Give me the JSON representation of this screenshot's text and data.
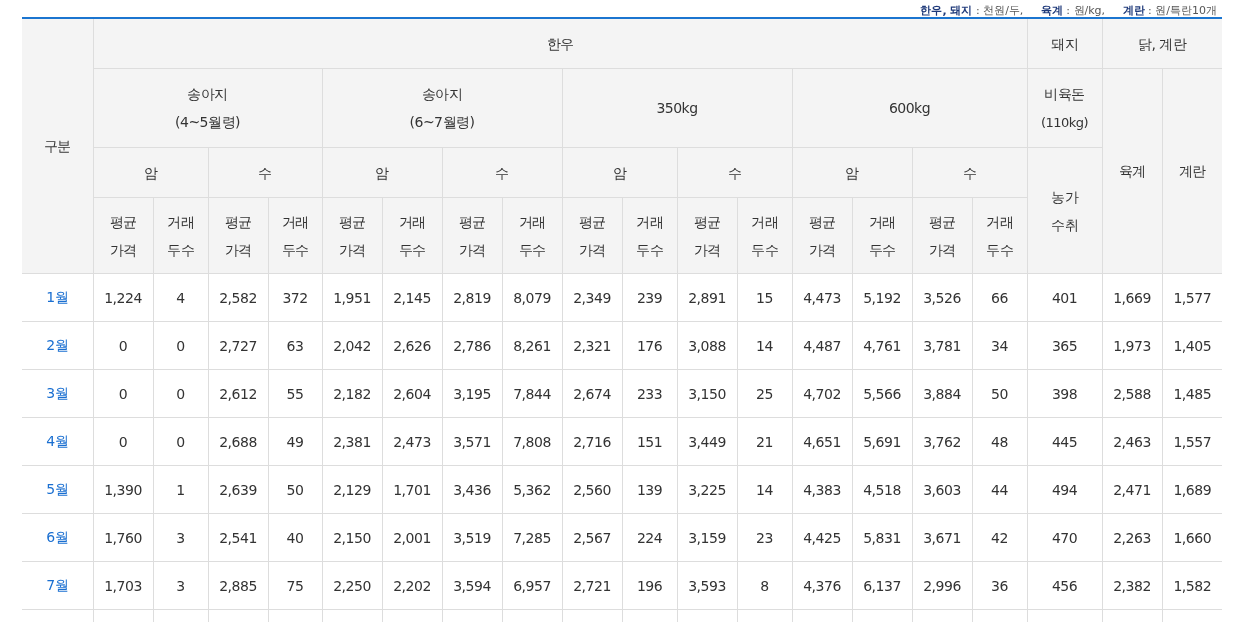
{
  "unit_note": "**한우, 돼지** : 천원/두,     **육계** : 원/kg,     **계란** : 원/특란10개",
  "header": {
    "category": "구분",
    "hanwoo": "한우",
    "pork": "돼지",
    "poultry": "닭, 계란",
    "hanwoo_groups": [
      {
        "label": "송아지",
        "sub": "(4~5월령)",
        "sexes": [
          {
            "label": "암",
            "columns": [
              "평균\n가격",
              "거래\n두수"
            ]
          },
          {
            "label": "수",
            "columns": [
              "평균\n가격",
              "거래\n두수"
            ]
          }
        ]
      },
      {
        "label": "송아지",
        "sub": "(6~7월령)",
        "sexes": [
          {
            "label": "암",
            "columns": [
              "평균\n가격",
              "거래\n두수"
            ]
          },
          {
            "label": "수",
            "columns": [
              "평균\n가격",
              "거래\n두수"
            ]
          }
        ]
      },
      {
        "label": "350kg",
        "sexes": [
          {
            "label": "암",
            "columns": [
              "평균\n가격",
              "거래\n두수"
            ]
          },
          {
            "label": "수",
            "columns": [
              "평균\n가격",
              "거래\n두수"
            ]
          }
        ]
      },
      {
        "label": "600kg",
        "sexes": [
          {
            "label": "암",
            "columns": [
              "평균\n가격",
              "거래\n두수"
            ]
          },
          {
            "label": "수",
            "columns": [
              "평균\n가격",
              "거래\n두수"
            ]
          }
        ]
      }
    ],
    "pork_group": {
      "label": "비육돈",
      "sub": "(110kg)",
      "column": "농가\n수취"
    },
    "poultry_columns": [
      "육계",
      "계란"
    ]
  },
  "rows": [
    {
      "month": "1월",
      "values": [
        "1,224",
        "4",
        "2,582",
        "372",
        "1,951",
        "2,145",
        "2,819",
        "8,079",
        "2,349",
        "239",
        "2,891",
        "15",
        "4,473",
        "5,192",
        "3,526",
        "66",
        "401",
        "1,669",
        "1,577"
      ]
    },
    {
      "month": "2월",
      "values": [
        "0",
        "0",
        "2,727",
        "63",
        "2,042",
        "2,626",
        "2,786",
        "8,261",
        "2,321",
        "176",
        "3,088",
        "14",
        "4,487",
        "4,761",
        "3,781",
        "34",
        "365",
        "1,973",
        "1,405"
      ]
    },
    {
      "month": "3월",
      "values": [
        "0",
        "0",
        "2,612",
        "55",
        "2,182",
        "2,604",
        "3,195",
        "7,844",
        "2,674",
        "233",
        "3,150",
        "25",
        "4,702",
        "5,566",
        "3,884",
        "50",
        "398",
        "2,588",
        "1,485"
      ]
    },
    {
      "month": "4월",
      "values": [
        "0",
        "0",
        "2,688",
        "49",
        "2,381",
        "2,473",
        "3,571",
        "7,808",
        "2,716",
        "151",
        "3,449",
        "21",
        "4,651",
        "5,691",
        "3,762",
        "48",
        "445",
        "2,463",
        "1,557"
      ]
    },
    {
      "month": "5월",
      "values": [
        "1,390",
        "1",
        "2,639",
        "50",
        "2,129",
        "1,701",
        "3,436",
        "5,362",
        "2,560",
        "139",
        "3,225",
        "14",
        "4,383",
        "4,518",
        "3,603",
        "44",
        "494",
        "2,471",
        "1,689"
      ]
    },
    {
      "month": "6월",
      "values": [
        "1,760",
        "3",
        "2,541",
        "40",
        "2,150",
        "2,001",
        "3,519",
        "7,285",
        "2,567",
        "224",
        "3,159",
        "23",
        "4,425",
        "5,831",
        "3,671",
        "42",
        "470",
        "2,263",
        "1,660"
      ]
    },
    {
      "month": "7월",
      "values": [
        "1,703",
        "3",
        "2,885",
        "75",
        "2,250",
        "2,202",
        "3,594",
        "6,957",
        "2,721",
        "196",
        "3,593",
        "8",
        "4,376",
        "6,137",
        "2,996",
        "36",
        "456",
        "2,382",
        "1,582"
      ]
    }
  ]
}
